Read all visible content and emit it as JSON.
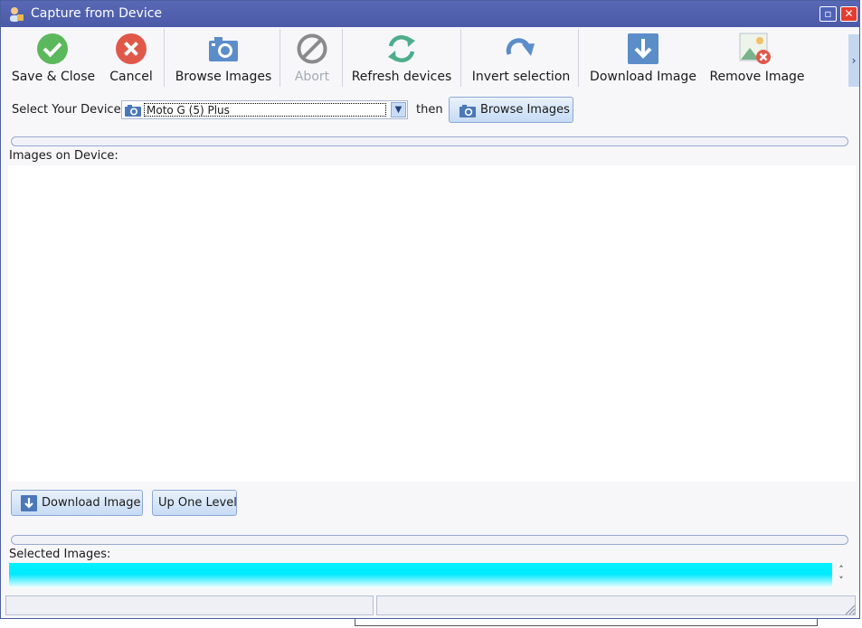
{
  "window": {
    "title": "Capture from Device",
    "controls": {
      "restore": "▫",
      "close": "✕"
    }
  },
  "toolbar": {
    "save_close": "Save & Close",
    "cancel": "Cancel",
    "browse_images": "Browse Images",
    "abort": "Abort",
    "refresh_devices": "Refresh devices",
    "invert_selection": "Invert selection",
    "download_image": "Download Image",
    "remove_image": "Remove Image",
    "scroll_right": "›"
  },
  "device": {
    "label": "Select Your Device",
    "selected": "Moto G (5) Plus",
    "then": "then",
    "browse_button": "Browse Images"
  },
  "images_on_device": {
    "label": "Images on Device:"
  },
  "actions": {
    "download_image": "Download Image",
    "up_one_level": "Up One Level"
  },
  "selected_images": {
    "label": "Selected Images:"
  },
  "colors": {
    "titlebar": "#5565b0",
    "save_green": "#5cb85c",
    "cancel_red": "#e0584a",
    "icon_blue": "#5b8dc9",
    "refresh_green": "#4cae8a",
    "abort_gray": "#8a8a8a",
    "selected_cyan": "#00f0ff"
  }
}
